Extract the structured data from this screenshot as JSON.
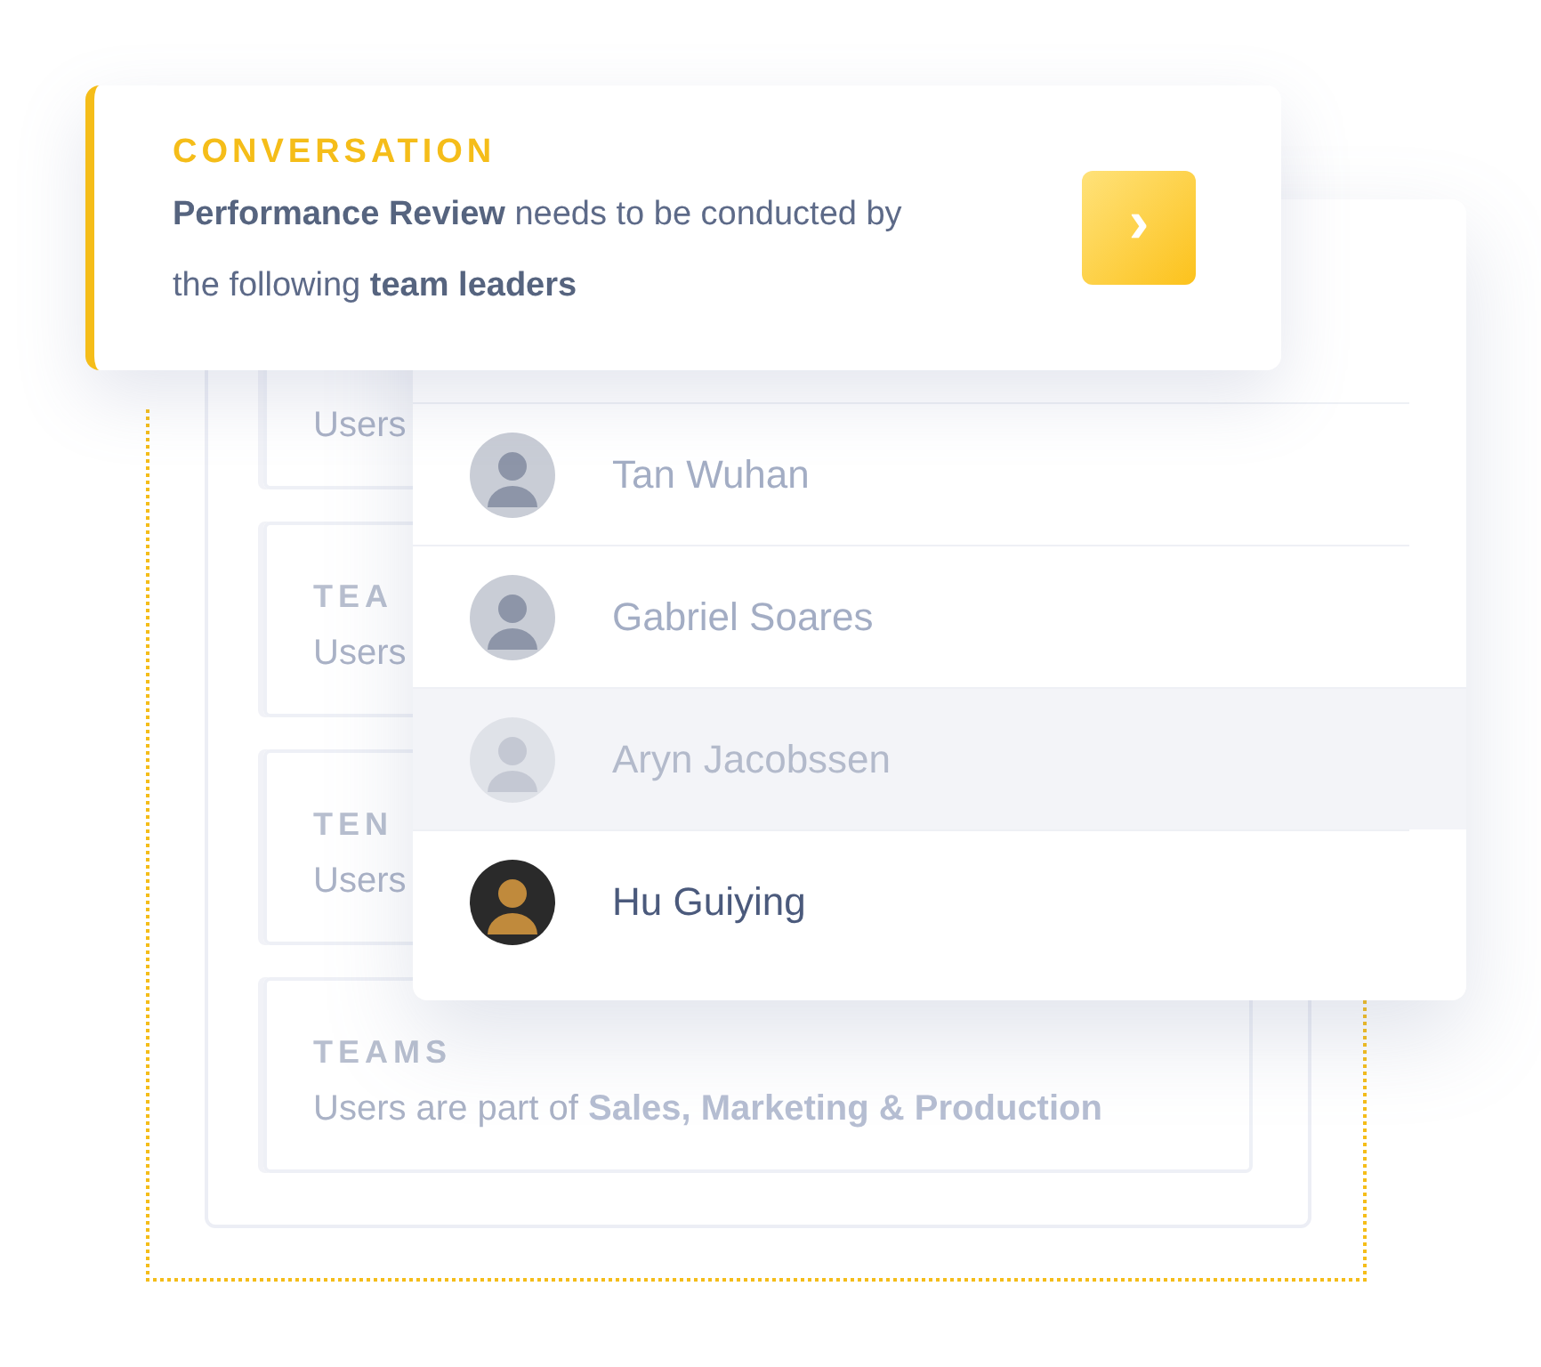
{
  "team_cards": [
    {
      "text": "Users"
    },
    {
      "label": "TEA",
      "text": "Users"
    },
    {
      "label": "TEN",
      "text": "Users"
    },
    {
      "label": "TEAMS",
      "text": "Users are part of **Sales, Marketing & Production**"
    }
  ],
  "people": [
    {
      "name": "Tan Wuhan",
      "dimmed": false,
      "selected": false
    },
    {
      "name": "Gabriel Soares",
      "dimmed": false,
      "selected": false
    },
    {
      "name": "Aryn Jacobssen",
      "dimmed": true,
      "selected": false
    },
    {
      "name": "Hu Guiying",
      "dimmed": false,
      "selected": true
    }
  ],
  "conversation": {
    "label": "CONVERSATION",
    "text": "**Performance Review** needs to be conducted by the following **team leaders**",
    "button": "›"
  }
}
